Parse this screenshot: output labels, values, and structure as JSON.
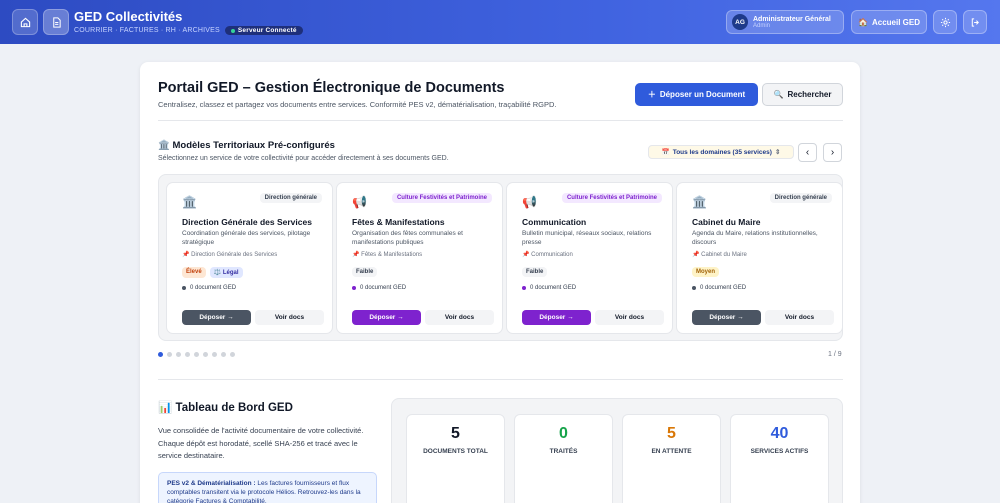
{
  "header": {
    "title": "GED Collectivités",
    "subtitle": "COURRIER · FACTURES · RH · ARCHIVES",
    "server_status": "Serveur Connecté",
    "user_initials": "AG",
    "user_name": "Administrateur Général",
    "user_role": "Admin",
    "home_label": "Accueil GED"
  },
  "page": {
    "title": "Portail GED – Gestion Électronique de Documents",
    "subtitle": "Centralisez, classez et partagez vos documents entre services. Conformité PES v2, dématérialisation, traçabilité RGPD.",
    "upload_label": "Déposer un Document",
    "search_label": "Rechercher"
  },
  "models": {
    "title": "Modèles Territoriaux Pré-configurés",
    "subtitle": "Sélectionnez un service de votre collectivité pour accéder directement à ses documents GED.",
    "domain_filter": "Tous les domaines (35 services)",
    "pager": "1 / 9",
    "cards": [
      {
        "icon": "building-icon",
        "tag": "Direction générale",
        "tag_color": "#374151",
        "title": "Direction Générale des Services",
        "desc": "Coordination générale des services, pilotage stratégique",
        "service": "Direction Générale des Services",
        "badges": [
          {
            "label": "Élevé",
            "bg": "#fde7d4",
            "fg": "#c2410c"
          },
          {
            "label": "⚖️ Légal",
            "bg": "#e0e7ff",
            "fg": "#3730a3"
          }
        ],
        "docs": "0 document GED",
        "accent": "#4b5563",
        "deposit_label": "Déposer →",
        "view_label": "Voir docs"
      },
      {
        "icon": "megaphone-icon",
        "tag": "Culture Festivités et Patrimoine",
        "tag_color": "#7e22ce",
        "title": "Fêtes & Manifestations",
        "desc": "Organisation des fêtes communales et manifestations publiques",
        "service": "Fêtes & Manifestations",
        "badges": [
          {
            "label": "Faible",
            "bg": "#f3f4f6",
            "fg": "#374151"
          }
        ],
        "docs": "0 document GED",
        "accent": "#7e22ce",
        "deposit_label": "Déposer →",
        "view_label": "Voir docs"
      },
      {
        "icon": "megaphone-icon",
        "tag": "Culture Festivités et Patrimoine",
        "tag_color": "#7e22ce",
        "title": "Communication",
        "desc": "Bulletin municipal, réseaux sociaux, relations presse",
        "service": "Communication",
        "badges": [
          {
            "label": "Faible",
            "bg": "#f3f4f6",
            "fg": "#374151"
          }
        ],
        "docs": "0 document GED",
        "accent": "#7e22ce",
        "deposit_label": "Déposer →",
        "view_label": "Voir docs"
      },
      {
        "icon": "building-icon",
        "tag": "Direction générale",
        "tag_color": "#374151",
        "title": "Cabinet du Maire",
        "desc": "Agenda du Maire, relations institutionnelles, discours",
        "service": "Cabinet du Maire",
        "badges": [
          {
            "label": "Moyen",
            "bg": "#fef3c7",
            "fg": "#a16207"
          }
        ],
        "docs": "0 document GED",
        "accent": "#4b5563",
        "deposit_label": "Déposer →",
        "view_label": "Voir docs"
      }
    ]
  },
  "dashboard": {
    "title": "Tableau de Bord GED",
    "text": "Vue consolidée de l'activité documentaire de votre collectivité. Chaque dépôt est horodaté, scellé SHA-256 et tracé avec le service destinataire.",
    "pes_title": "PES v2 & Dématérialisation :",
    "pes_text": "Les factures fournisseurs et flux comptables transitent via le protocole Hélios. Retrouvez-les dans la catégorie Factures & Comptabilité.",
    "stats": [
      {
        "value": "5",
        "label": "DOCUMENTS TOTAL",
        "color": "#111827"
      },
      {
        "value": "0",
        "label": "TRAITÉS",
        "color": "#16a34a"
      },
      {
        "value": "5",
        "label": "EN ATTENTE",
        "color": "#d97706"
      },
      {
        "value": "40",
        "label": "SERVICES ACTIFS",
        "color": "#2f5bdc"
      }
    ]
  }
}
